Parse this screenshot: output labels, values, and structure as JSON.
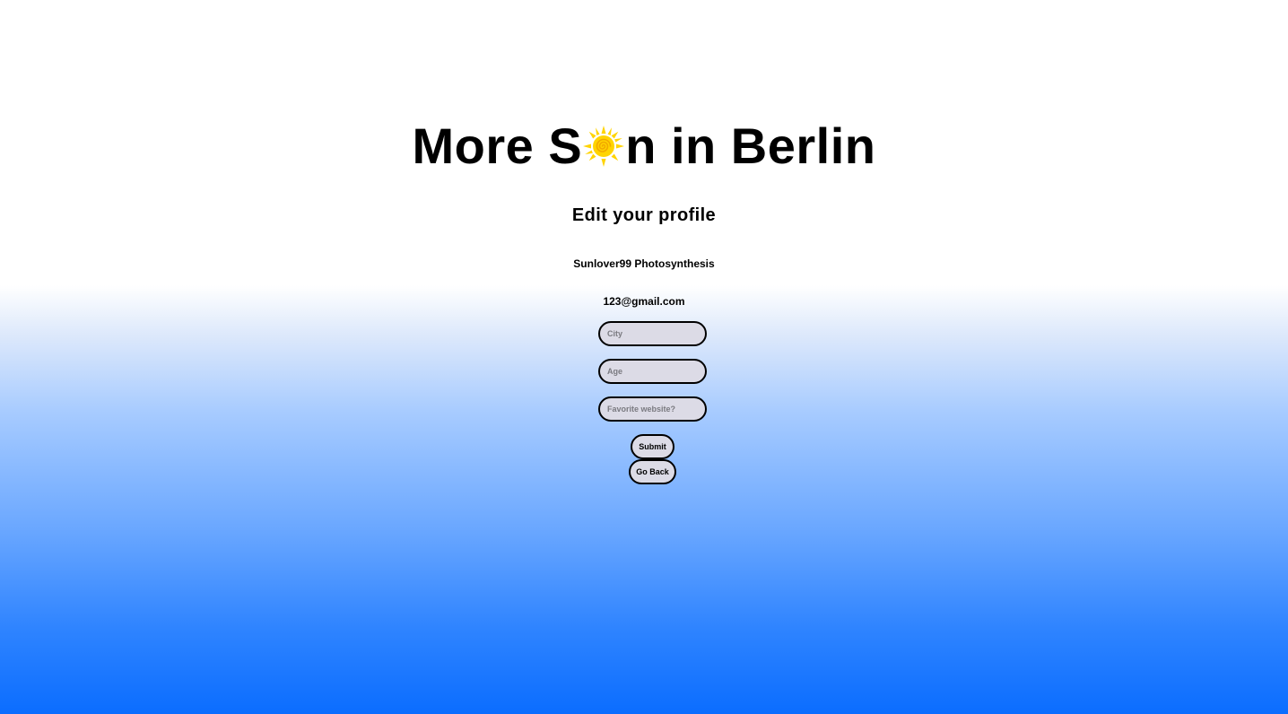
{
  "header": {
    "title_before_icon": "More S",
    "title_icon": "sun-icon",
    "title_after_icon": "n in Berlin",
    "sun_color": "#FFD400"
  },
  "profile": {
    "heading": "Edit your profile",
    "name": "Sunlover99 Photosynthesis",
    "email": "123@gmail.com"
  },
  "form": {
    "city_placeholder": "City",
    "age_placeholder": "Age",
    "website_placeholder": "Favorite website?",
    "submit_label": "Submit",
    "back_label": "Go Back"
  },
  "colors": {
    "gradient_top": "#ffffff",
    "gradient_bottom": "#0b6dff",
    "input_fill": "#dcdbe6"
  }
}
